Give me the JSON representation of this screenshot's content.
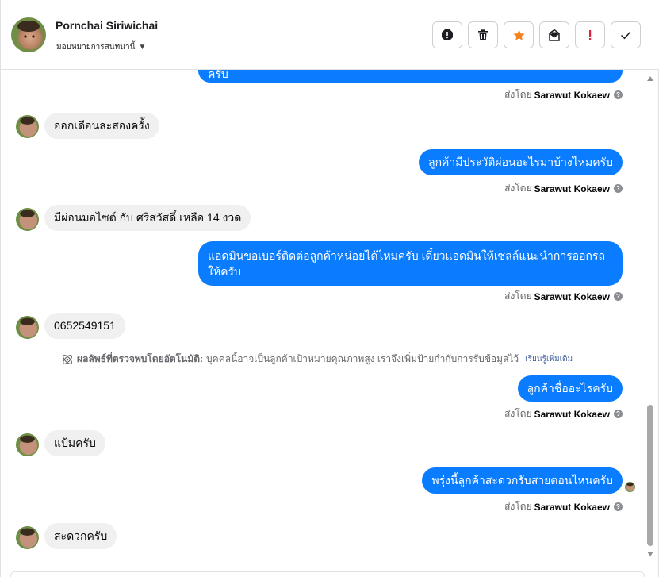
{
  "header": {
    "contact_name": "Pornchai Siriwichai",
    "assign_label": "มอบหมายการสนทนานี้",
    "actions": [
      {
        "name": "report-spam-icon"
      },
      {
        "name": "trash-icon"
      },
      {
        "name": "star-icon"
      },
      {
        "name": "mark-unread-icon"
      },
      {
        "name": "follow-up-icon"
      },
      {
        "name": "done-check-icon"
      }
    ]
  },
  "messages": [
    {
      "dir": "out",
      "text": "ครับ"
    },
    {
      "dir": "in",
      "text": "ออกเดือนละสองครั้ง"
    },
    {
      "dir": "out",
      "text": "ลูกค้ามีประวัติผ่อนอะไรมาบ้างไหมครับ"
    },
    {
      "dir": "in",
      "text": "มีผ่อนมอไซต์ กับ ศรีสวัสดิ์ เหลือ 14 งวด"
    },
    {
      "dir": "out",
      "text": "แอดมินขอเบอร์ติดต่อลูกค้าหน่อยได้ไหมครับ เดี๋ยวแอดมินให้เซลล์แนะนำการออกรถให้ครับ"
    },
    {
      "dir": "in",
      "text": "0652549151"
    },
    {
      "dir": "out",
      "text": "ลูกค้าชื่ออะไรครับ"
    },
    {
      "dir": "in",
      "text": "แป้มครับ"
    },
    {
      "dir": "out",
      "text": "พรุ่งนี้ลูกค้าสะดวกรับสายตอนไหนครับ"
    },
    {
      "dir": "in",
      "text": "สะดวกครับ"
    }
  ],
  "sent_by": {
    "prefix": "ส่งโดย",
    "agent": "Sarawut Kokaew",
    "help": "?"
  },
  "auto_detect": {
    "label": "ผลลัพธ์ที่ตรวจพบโดยอัตโนมัติ:",
    "text": "บุคคลนี้อาจเป็นลูกค้าเป้าหมายคุณภาพสูง เราจึงเพิ่มป้ายกำกับการรับข้อมูลไว้",
    "learn_more": "เรียนรู้เพิ่มเติม"
  },
  "colors": {
    "outgoing_bubble": "#0a7cff",
    "incoming_bubble": "#f0f0f0",
    "star": "#f5821f",
    "alert": "#e41e3f"
  }
}
